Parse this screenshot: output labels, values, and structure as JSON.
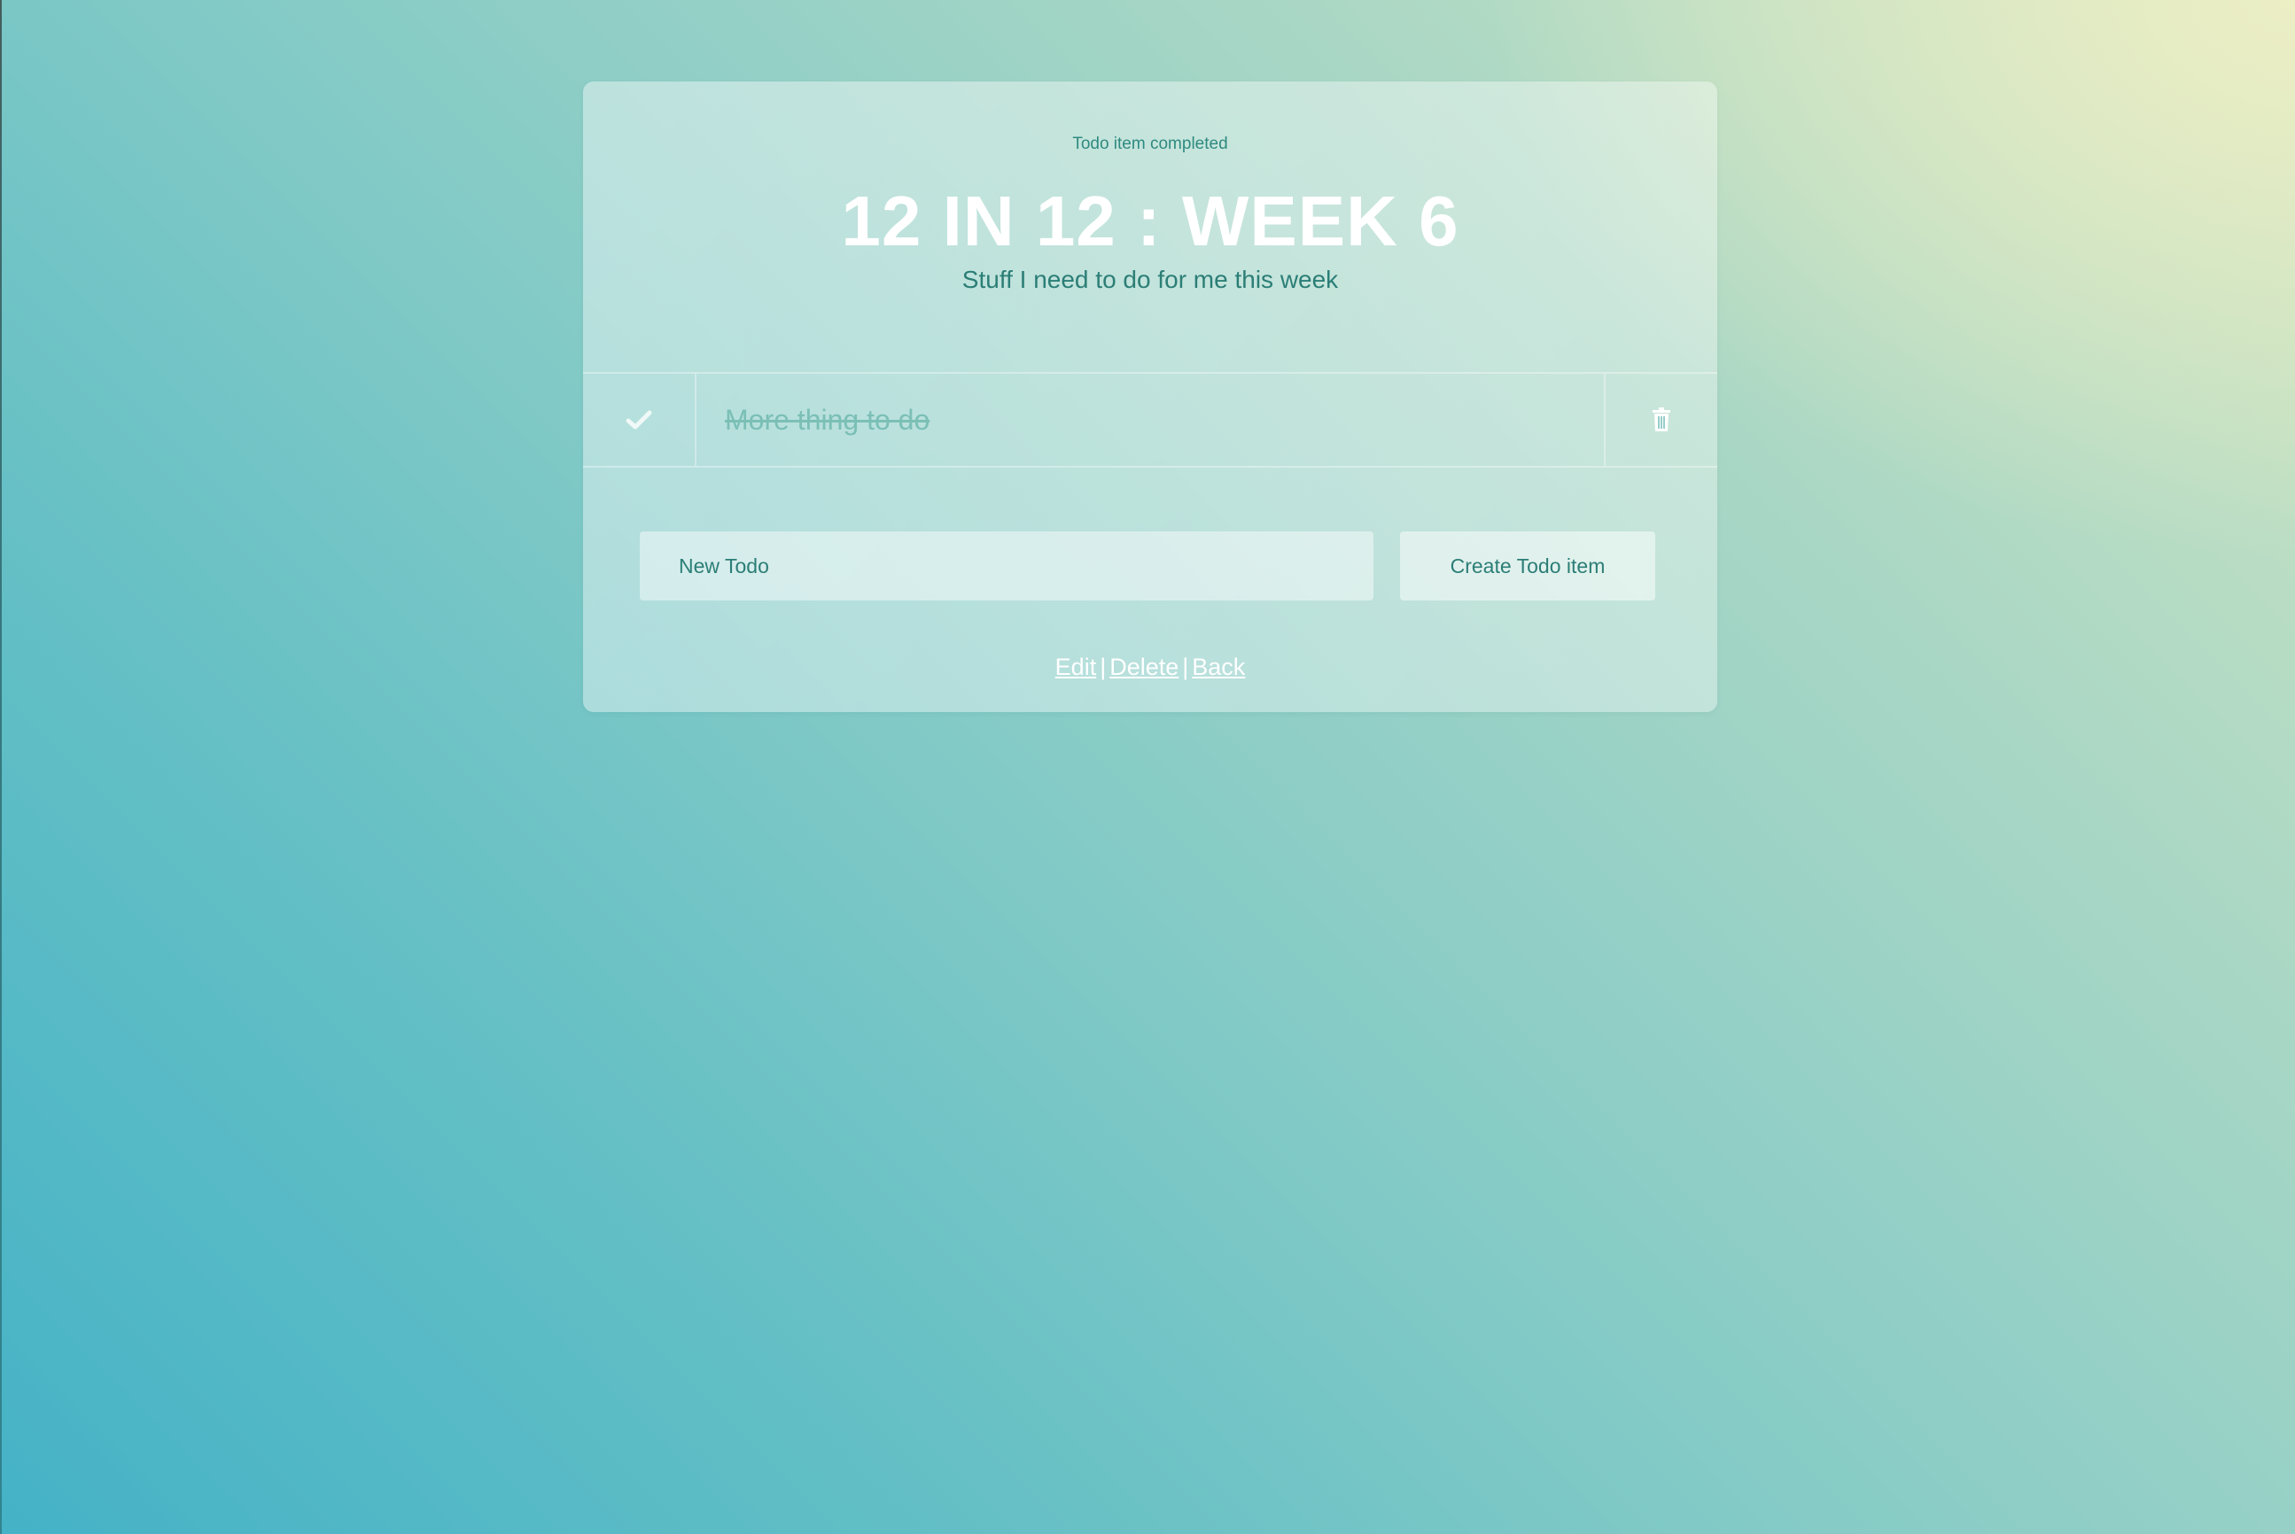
{
  "flash": {
    "message": "Todo item completed"
  },
  "header": {
    "title": "12 IN 12 : WEEK 6",
    "subtitle": "Stuff I need to do for me this week"
  },
  "todo_items": [
    {
      "text": "More thing to do",
      "completed": true,
      "check_icon": "check-icon",
      "delete_icon": "trash-icon"
    }
  ],
  "new_todo": {
    "placeholder": "New Todo",
    "submit_label": "Create Todo item"
  },
  "footer_links": {
    "edit": "Edit",
    "separator": "|",
    "delete": "Delete",
    "back": "Back"
  },
  "colors": {
    "accent_text": "#2b7e76",
    "completed_text": "#7bbfb6",
    "title": "#ffffff"
  }
}
